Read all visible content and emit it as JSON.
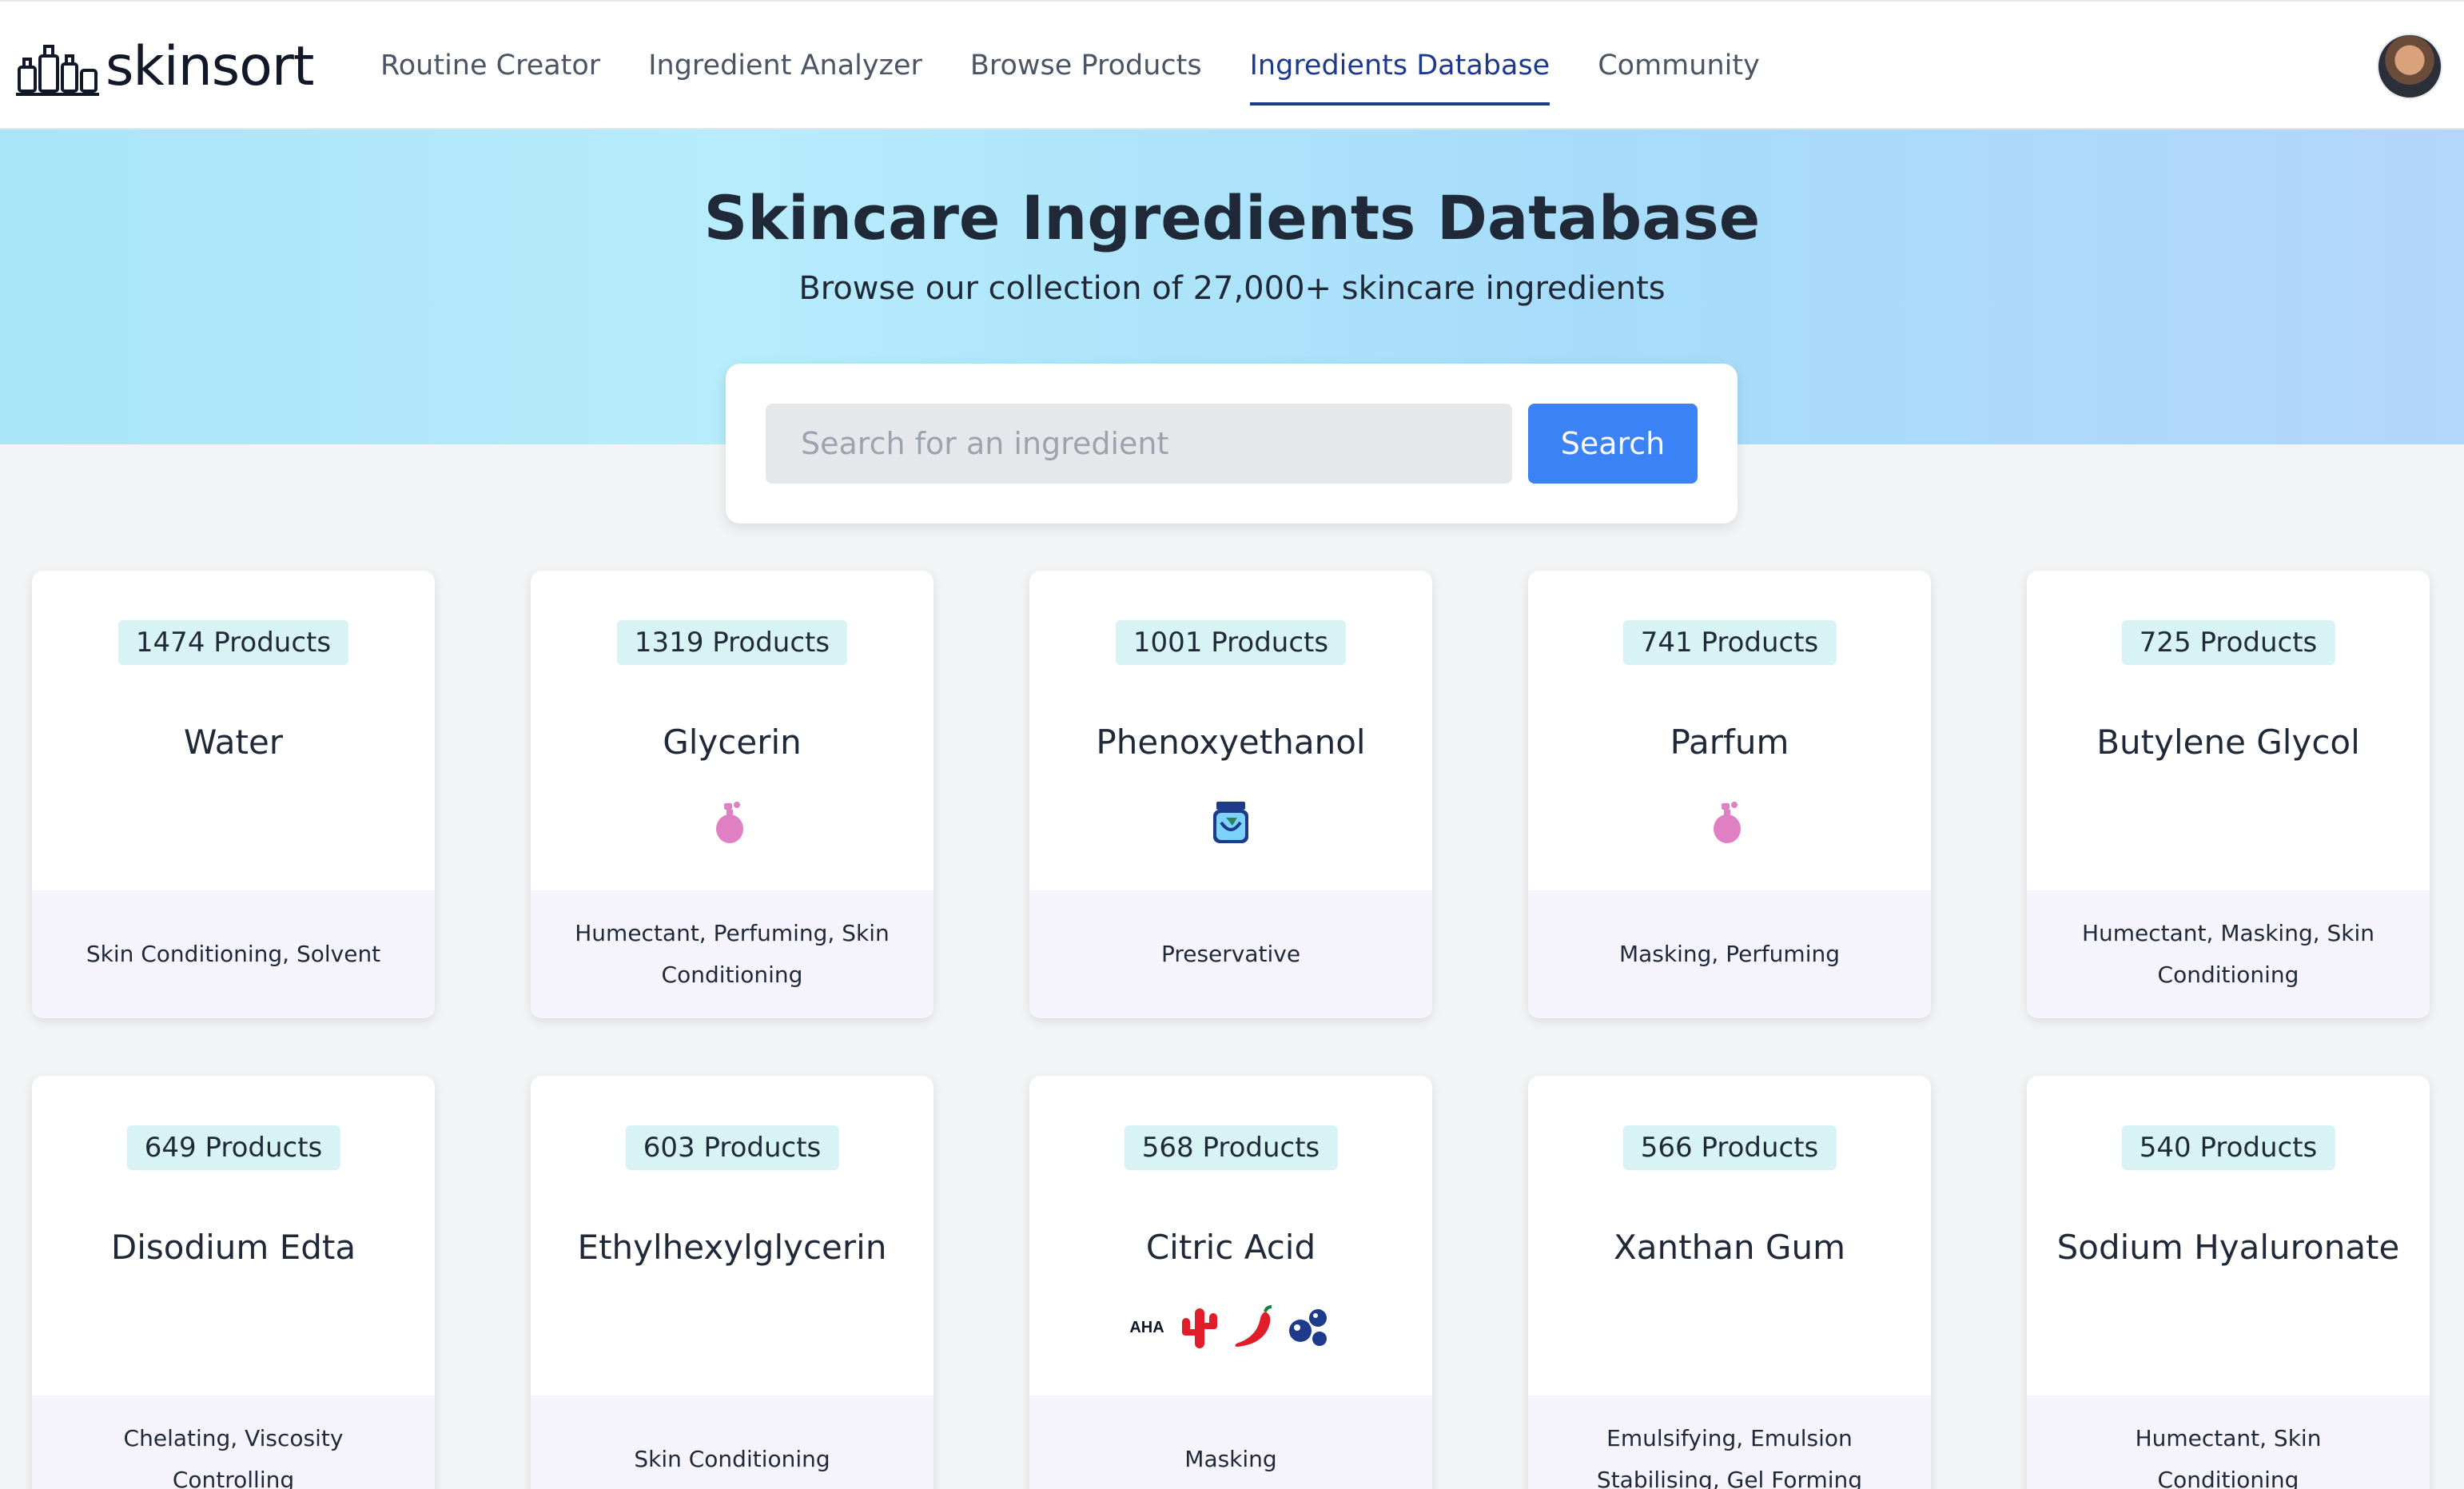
{
  "brand": {
    "name": "skinsort"
  },
  "nav": {
    "links": [
      {
        "label": "Routine Creator"
      },
      {
        "label": "Ingredient Analyzer"
      },
      {
        "label": "Browse Products"
      },
      {
        "label": "Ingredients Database",
        "active": true
      },
      {
        "label": "Community"
      }
    ]
  },
  "hero": {
    "title": "Skincare Ingredients Database",
    "subtitle": "Browse our collection of 27,000+ skincare ingredients"
  },
  "search": {
    "placeholder": "Search for an ingredient",
    "button_label": "Search"
  },
  "colors": {
    "accent": "#3b82f6",
    "nav_active": "#1e3a8a",
    "badge_bg": "#d8f3f4",
    "card_footer_bg": "#f5f4fd"
  },
  "ingredients": [
    {
      "count": "1474 Products",
      "name": "Water",
      "icons": [],
      "functions": "Skin Conditioning, Solvent"
    },
    {
      "count": "1319 Products",
      "name": "Glycerin",
      "icons": [
        "perfume-bottle-icon"
      ],
      "functions": "Humectant, Perfuming, Skin Conditioning"
    },
    {
      "count": "1001 Products",
      "name": "Phenoxyethanol",
      "icons": [
        "preservative-jar-icon"
      ],
      "functions": "Preservative"
    },
    {
      "count": "741 Products",
      "name": "Parfum",
      "icons": [
        "perfume-bottle-icon"
      ],
      "functions": "Masking, Perfuming"
    },
    {
      "count": "725 Products",
      "name": "Butylene Glycol",
      "icons": [],
      "functions": "Humectant, Masking, Skin Conditioning"
    },
    {
      "count": "649 Products",
      "name": "Disodium Edta",
      "icons": [],
      "functions": "Chelating, Viscosity Controlling"
    },
    {
      "count": "603 Products",
      "name": "Ethylhexylglycerin",
      "icons": [],
      "functions": "Skin Conditioning"
    },
    {
      "count": "568 Products",
      "name": "Citric Acid",
      "icons": [
        "aha-icon",
        "cactus-icon",
        "chili-pepper-icon",
        "bubbles-icon"
      ],
      "aha_label": "AHA",
      "functions": "Masking"
    },
    {
      "count": "566 Products",
      "name": "Xanthan Gum",
      "icons": [],
      "functions": "Emulsifying, Emulsion Stabilising, Gel Forming"
    },
    {
      "count": "540 Products",
      "name": "Sodium Hyaluronate",
      "icons": [],
      "functions": "Humectant, Skin Conditioning"
    }
  ]
}
